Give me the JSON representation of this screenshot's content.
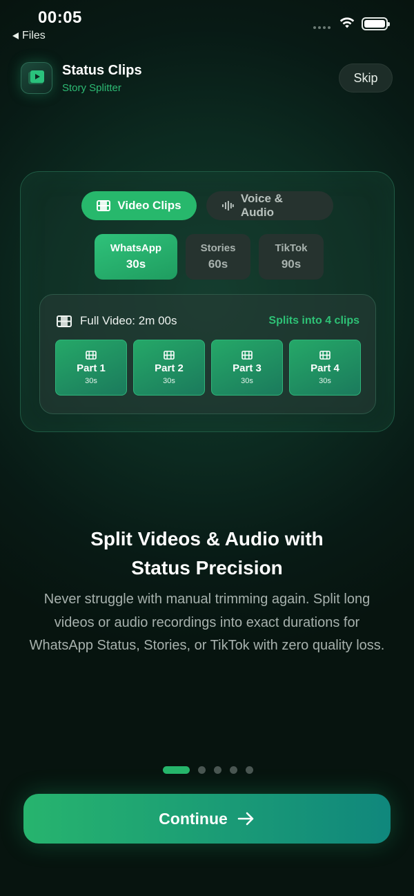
{
  "status_bar": {
    "time": "00:05",
    "back_label": "Files"
  },
  "header": {
    "app_name": "Status Clips",
    "subtitle": "Story Splitter",
    "skip_label": "Skip"
  },
  "mode_tabs": [
    {
      "label": "Video Clips",
      "icon": "film-icon",
      "active": true
    },
    {
      "label": "Voice & Audio",
      "icon": "waveform-icon",
      "active": false
    }
  ],
  "platforms": [
    {
      "name": "WhatsApp",
      "duration": "30s",
      "active": true
    },
    {
      "name": "Stories",
      "duration": "60s",
      "active": false
    },
    {
      "name": "TikTok",
      "duration": "90s",
      "active": false
    }
  ],
  "preview": {
    "full_video_label": "Full Video: 2m 00s",
    "splits_label": "Splits into 4 clips",
    "parts": [
      {
        "label": "Part 1",
        "duration": "30s"
      },
      {
        "label": "Part 2",
        "duration": "30s"
      },
      {
        "label": "Part 3",
        "duration": "30s"
      },
      {
        "label": "Part 4",
        "duration": "30s"
      }
    ]
  },
  "content": {
    "headline_line1": "Split Videos & Audio with",
    "headline_line2": "Status Precision",
    "description": "Never struggle with manual trimming again. Split long videos or audio recordings into exact durations for WhatsApp Status, Stories, or TikTok with zero quality loss."
  },
  "pagination": {
    "total": 5,
    "current": 1
  },
  "continue_label": "Continue",
  "colors": {
    "accent": "#27b86c",
    "accent_text": "#2dbb74",
    "background": "#0a1f18"
  }
}
